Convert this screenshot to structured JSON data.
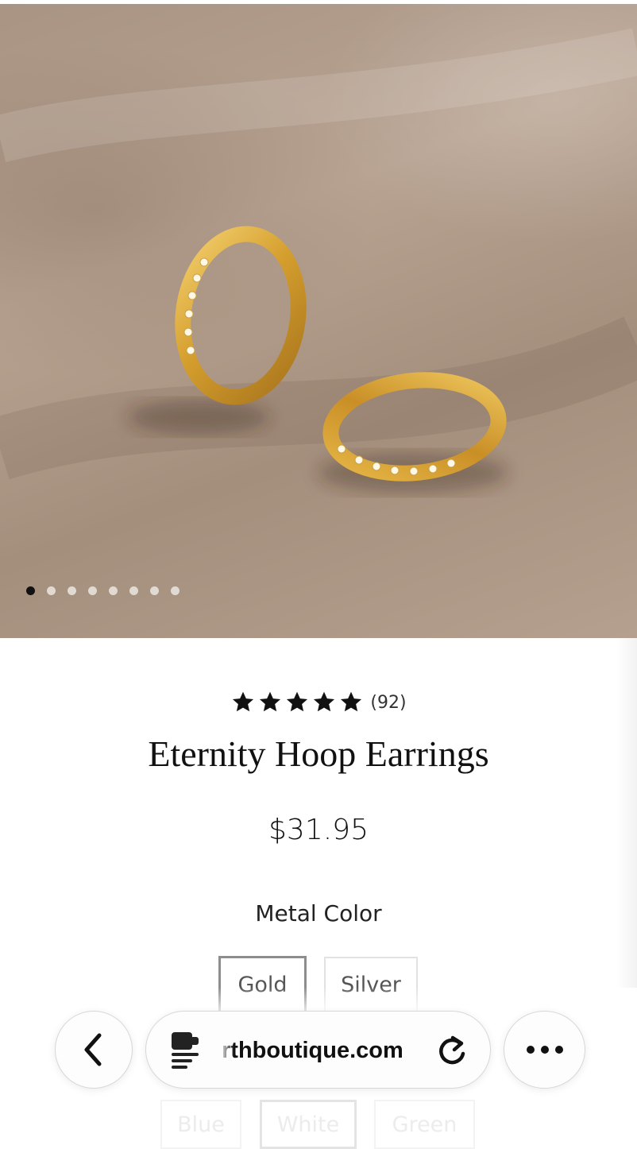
{
  "product": {
    "review_count": "(92)",
    "rating": 5,
    "title": "Eternity Hoop Earrings",
    "price": "$31.95",
    "option_label": "Metal Color",
    "image_count": 8,
    "active_image": 1
  },
  "metal_options": [
    {
      "label": "Gold",
      "selected": true
    },
    {
      "label": "Silver",
      "selected": false
    }
  ],
  "color_options": [
    {
      "label": "Blue",
      "selected": false
    },
    {
      "label": "White",
      "selected": true
    },
    {
      "label": "Green",
      "selected": false
    }
  ],
  "browser": {
    "url": "rthboutique.com",
    "back_icon": "chevron-left-icon",
    "page_icon": "reader-mode-icon",
    "reload_icon": "reload-icon",
    "more_icon": "more-horizontal-icon"
  },
  "colors": {
    "gold": "#d9a63a",
    "fabric": "#b09b89",
    "text": "#111111"
  }
}
